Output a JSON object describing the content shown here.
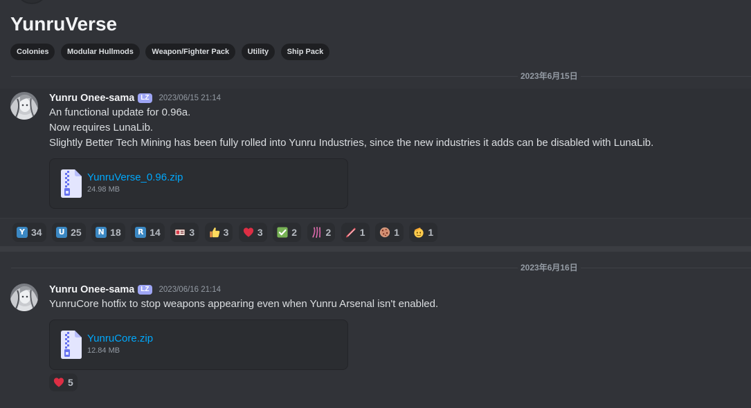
{
  "thread": {
    "title": "YunruVerse",
    "tags": [
      "Colonies",
      "Modular Hullmods",
      "Weapon/Fighter Pack",
      "Utility",
      "Ship Pack"
    ]
  },
  "messages": [
    {
      "date_divider": "2023年6月15日",
      "author": "Yunru Onee-sama",
      "badge": "LZ",
      "timestamp": "2023/06/15 21:14",
      "content": [
        "An functional update for 0.96a.",
        "Now requires LunaLib.",
        "Slightly Better Tech Mining has been fully rolled into Yunru Industries, since the new industries it adds can be disabled with LunaLib."
      ],
      "attachment": {
        "icon": "zip-file-icon",
        "filename": "YunruVerse_0.96.zip",
        "size": "24.98 MB"
      },
      "reactions": [
        {
          "emoji": "regional-indicator-y",
          "letter": "Y",
          "count": 34
        },
        {
          "emoji": "regional-indicator-u",
          "letter": "U",
          "count": 25
        },
        {
          "emoji": "regional-indicator-n",
          "letter": "N",
          "count": 18
        },
        {
          "emoji": "regional-indicator-r",
          "letter": "R",
          "count": 14
        },
        {
          "emoji": "custom-emoji-banner",
          "count": 3
        },
        {
          "emoji": "thumbs-up",
          "count": 3
        },
        {
          "emoji": "heart",
          "count": 3
        },
        {
          "emoji": "white-check-mark",
          "count": 2
        },
        {
          "emoji": "custom-emoji-claw-marks",
          "count": 2
        },
        {
          "emoji": "custom-emoji-slash",
          "count": 1
        },
        {
          "emoji": "cookie",
          "count": 1
        },
        {
          "emoji": "saluting-face",
          "count": 1
        }
      ]
    },
    {
      "date_divider": "2023年6月16日",
      "author": "Yunru Onee-sama",
      "badge": "LZ",
      "timestamp": "2023/06/16 21:14",
      "content": [
        "YunruCore hotfix to stop weapons appearing even when Yunru Arsenal isn't enabled."
      ],
      "attachment": {
        "icon": "zip-file-icon",
        "filename": "YunruCore.zip",
        "size": "12.84 MB"
      },
      "reactions": [
        {
          "emoji": "heart",
          "count": 5
        }
      ]
    }
  ],
  "colors": {
    "background": "#313338",
    "link": "#00a8fc",
    "role_badge": "#9ea5f4",
    "regional_indicator": "#3b88c3",
    "heart": "#dd2e44"
  }
}
